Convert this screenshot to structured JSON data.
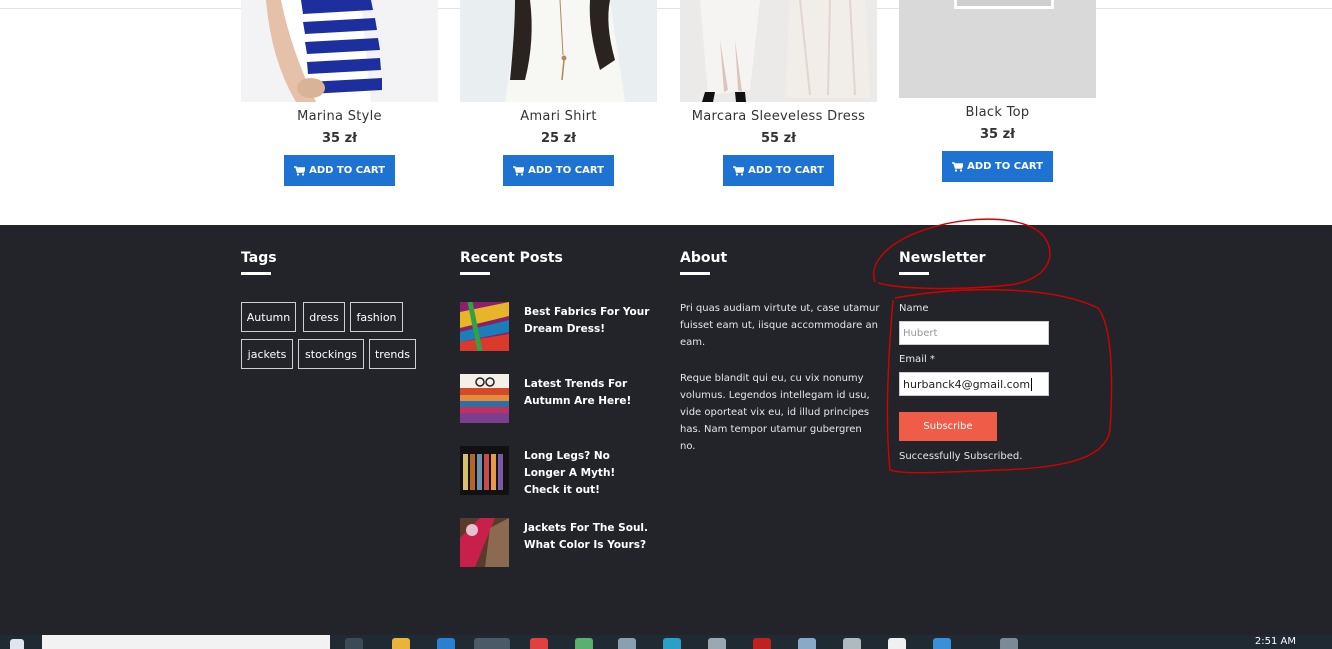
{
  "products": [
    {
      "name": "Marina Style",
      "price": "35 zł",
      "button": "ADD TO CART",
      "image": "striped-top-photo"
    },
    {
      "name": "Amari Shirt",
      "price": "25 zł",
      "button": "ADD TO CART",
      "image": "white-shirt-photo"
    },
    {
      "name": "Marcara Sleeveless Dress",
      "price": "55 zł",
      "button": "ADD TO CART",
      "image": "sleeveless-dress-photo"
    },
    {
      "name": "Black Top",
      "price": "35 zł",
      "button": "ADD TO CART",
      "image": "black-top-photo"
    }
  ],
  "footer": {
    "tags": {
      "heading": "Tags",
      "items": [
        "Autumn",
        "dress",
        "fashion",
        "jackets",
        "stockings",
        "trends"
      ]
    },
    "recent_posts": {
      "heading": "Recent Posts",
      "items": [
        {
          "title": "Best Fabrics For Your Dream Dress!"
        },
        {
          "title": "Latest Trends For Autumn Are Here!"
        },
        {
          "title": "Long Legs? No Longer A Myth! Check it out!"
        },
        {
          "title": "Jackets For The Soul. What Color Is Yours?"
        }
      ]
    },
    "about": {
      "heading": "About",
      "paragraphs": [
        "Pri quas audiam virtute ut, case utamur fuisset eam ut, iisque accommodare an eam.",
        "Reque blandit qui eu, cu vix nonumy volumus. Legendos intellegam id usu, vide oporteat vix eu, id illud principes has. Nam tempor utamur gubergren no."
      ]
    },
    "newsletter": {
      "heading": "Newsletter",
      "name_label": "Name",
      "name_placeholder": "Hubert",
      "email_label": "Email *",
      "email_value": "hurbanck4@gmail.com",
      "subscribe_label": "Subscribe",
      "status": "Successfully Subscribed."
    }
  },
  "taskbar": {
    "clock": "2:51 AM"
  },
  "colors": {
    "footer_bg": "#23242a",
    "cart_button": "#1e73d2",
    "subscribe_button": "#ef5c47",
    "annotation": "#d40000"
  }
}
